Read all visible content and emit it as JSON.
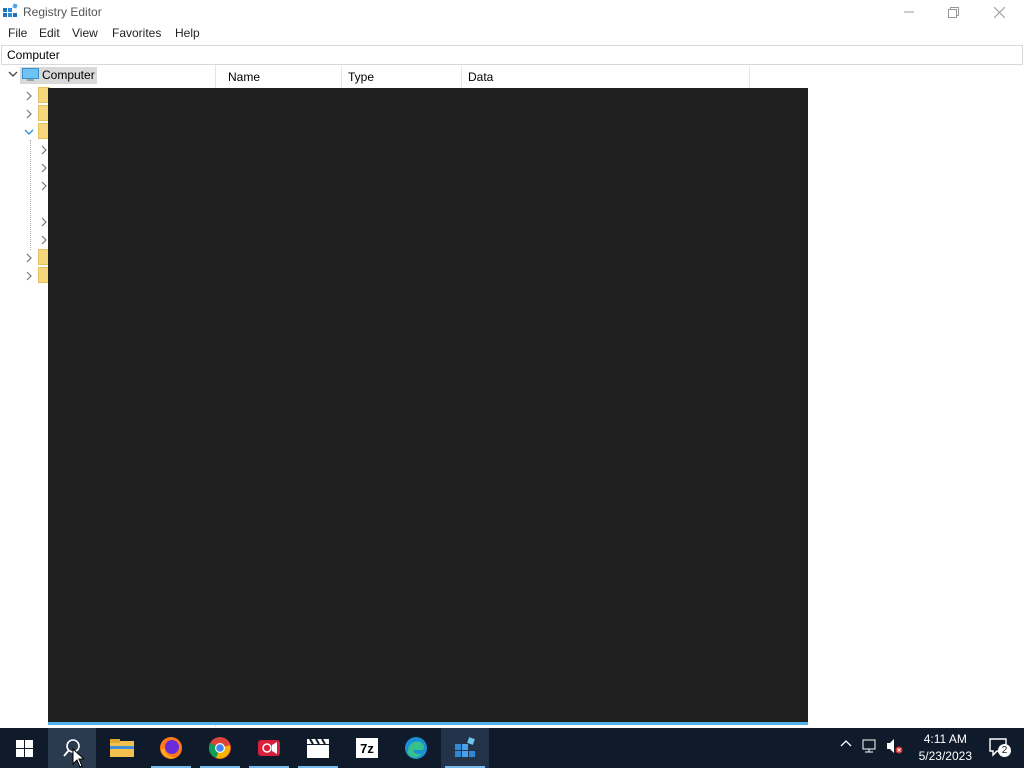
{
  "window": {
    "title": "Registry Editor",
    "icons": {
      "app": "registry-editor-icon",
      "minimize": "minimize-icon",
      "restore": "restore-icon",
      "close": "close-icon"
    }
  },
  "menu": {
    "file": "File",
    "edit": "Edit",
    "view": "View",
    "favorites": "Favorites",
    "help": "Help"
  },
  "address": {
    "value": "Computer"
  },
  "tree": {
    "root": "Computer"
  },
  "list": {
    "columns": {
      "name": "Name",
      "type": "Type",
      "data": "Data"
    }
  },
  "taskbar": {
    "apps": [
      "start-icon",
      "search-icon",
      "file-explorer-icon",
      "firefox-icon",
      "chrome-icon",
      "screen-recorder-icon",
      "clapperboard-icon",
      "7zip-icon",
      "edge-icon",
      "registry-editor-icon"
    ],
    "labels": {
      "sevenzip": "7z"
    },
    "time": "4:11 AM",
    "date": "5/23/2023",
    "notification_count": "2"
  },
  "colors": {
    "taskbar": "#0f1b2b",
    "overlay": "#202020",
    "accent": "#4fb3ea"
  }
}
